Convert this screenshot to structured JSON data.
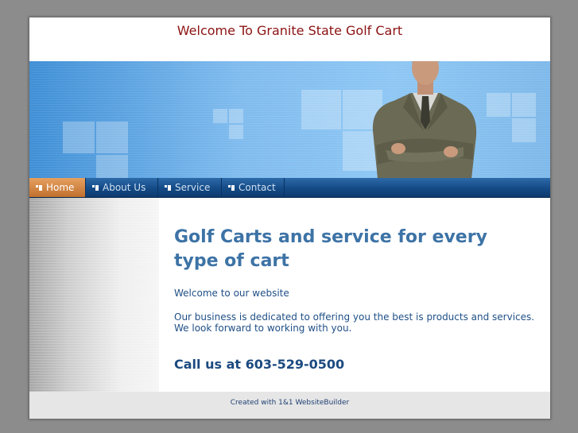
{
  "site": {
    "title": "Welcome To Granite State Golf Cart"
  },
  "nav": {
    "items": [
      {
        "label": "Home",
        "active": true
      },
      {
        "label": "About Us",
        "active": false
      },
      {
        "label": "Service",
        "active": false
      },
      {
        "label": "Contact",
        "active": false
      }
    ]
  },
  "main": {
    "headline": "Golf Carts and service for every type of cart",
    "welcome": "Welcome to our website",
    "body": "Our business is dedicated to offering you the best is products and services. We look forward to working with you.",
    "phone": "Call us at 603-529-0500"
  },
  "footer": {
    "credit": "Created with 1&1 WebsiteBuilder"
  },
  "colors": {
    "title": "#8b1212",
    "nav_bar": "#144a86",
    "nav_active": "#c0702e",
    "headline": "#3d73a6",
    "body_text": "#1f4f86"
  },
  "icons": {
    "nav_bullet": "nav-bullet-icon",
    "banner_figure": "businessman-image"
  }
}
